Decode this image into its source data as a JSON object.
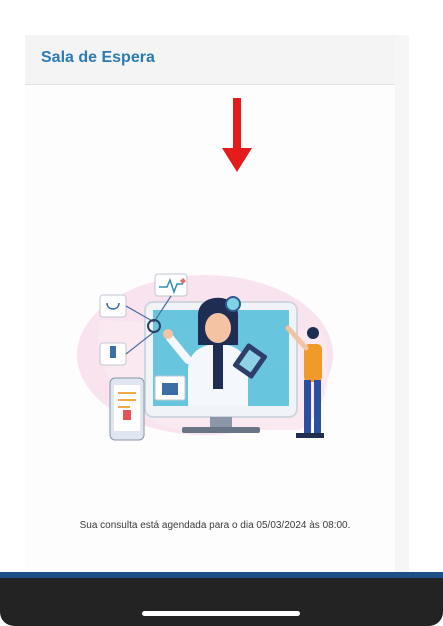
{
  "header": {
    "title": "Sala de Espera"
  },
  "message": "Sua consulta está agendada para o dia 05/03/2024 às 08:00.",
  "colors": {
    "accent": "#2a7bb5",
    "arrow": "#e31b1b",
    "nav_bar": "#232323",
    "nav_strip": "#1e4f86"
  },
  "icons": {
    "arrow": "down-arrow-icon",
    "illustration": "telemedicine-doctor-illustration"
  }
}
